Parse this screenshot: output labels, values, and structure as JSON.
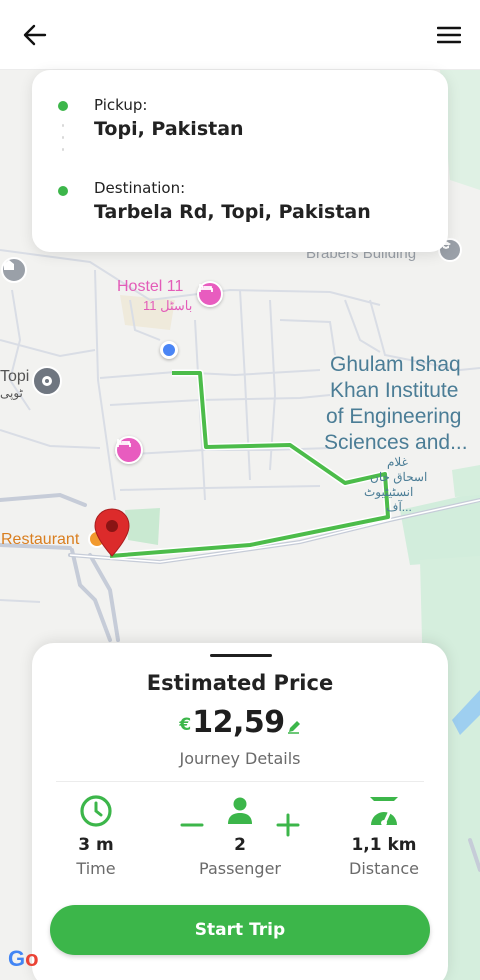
{
  "header": {
    "back_icon": "arrow-left-icon",
    "menu_icon": "hamburger-menu-icon"
  },
  "trip": {
    "pickup_label": "Pickup:",
    "pickup_value": "Topi, Pakistan",
    "destination_label": "Destination:",
    "destination_value": "Tarbela Rd, Topi, Pakistan"
  },
  "map": {
    "labels": {
      "hostel": "Hostel 11",
      "hostel_urdu": "باسٹل 11",
      "building": "Brabers Building",
      "topi": "Topi",
      "topi_urdu": "ٹوپی",
      "giki_line1": "Ghulam Ishaq",
      "giki_line2": "Khan Institute",
      "giki_line3": "of Engineering",
      "giki_line4": "Sciences and...",
      "giki_urdu_1": "غلام",
      "giki_urdu_2": "اسحاق خان",
      "giki_urdu_3": "انسٹیٹیوٹ",
      "giki_urdu_4": "آف...",
      "restaurant": "Restaurant"
    },
    "route_color": "#4cbc4a",
    "current_location_color": "#4a85f5",
    "destination_pin_color": "#dc2b2b"
  },
  "estimate": {
    "title": "Estimated Price",
    "currency": "€",
    "price": "12,59",
    "subtitle": "Journey Details",
    "stats": {
      "time_value": "3 m",
      "time_label": "Time",
      "passenger_value": "2",
      "passenger_label": "Passenger",
      "distance_value": "1,1 km",
      "distance_label": "Distance"
    },
    "icons": {
      "time": "clock-icon",
      "passenger": "person-icon",
      "distance": "speedometer-icon",
      "minus": "minus-icon",
      "plus": "plus-icon",
      "edit": "pencil-icon"
    }
  },
  "actions": {
    "start_trip": "Start Trip"
  },
  "footer": {
    "google_logo": "Go"
  },
  "colors": {
    "accent": "#3cb64a",
    "text": "#222222",
    "muted": "#6a6a6a"
  }
}
